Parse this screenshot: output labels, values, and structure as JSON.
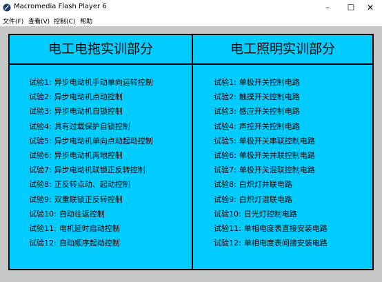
{
  "window": {
    "title": "Macromedia Flash Player 6",
    "minimize_glyph": "–",
    "maximize_glyph": "☐",
    "close_glyph": "✕"
  },
  "menu": [
    "文件(F)",
    "查看(V)",
    "控制(C)",
    "帮助"
  ],
  "left_column": {
    "title": "电工电拖实训部分",
    "items": [
      {
        "num": "试验1:",
        "text": "异步电动机手动单向运转控制"
      },
      {
        "num": "试验2:",
        "text": "异步电动机点动控制"
      },
      {
        "num": "试验3:",
        "text": "异步电动机自锁控制"
      },
      {
        "num": "试验4:",
        "text": "具有过载保护自锁控制"
      },
      {
        "num": "试验5:",
        "text": "异步电动机单向点动起动控制"
      },
      {
        "num": "试验6:",
        "text": "异步电动机两地控制"
      },
      {
        "num": "试验7:",
        "text": "异步电动机联锁正反转控制"
      },
      {
        "num": "试验8:",
        "text": "正反转点动、起动控制"
      },
      {
        "num": "试验9:",
        "text": "双重联锁正反转控制"
      },
      {
        "num": "试验10:",
        "text": "自动往返控制"
      },
      {
        "num": "试验11:",
        "text": "电机延时启动控制"
      },
      {
        "num": "试验12:",
        "text": "自动顺序起动控制"
      }
    ]
  },
  "right_column": {
    "title": "电工照明实训部分",
    "items": [
      {
        "num": "试验1:",
        "text": "单极开关控制电路"
      },
      {
        "num": "试验2:",
        "text": "触摸开关控制电路"
      },
      {
        "num": "试验3:",
        "text": "感应开关控制电路"
      },
      {
        "num": "试验4:",
        "text": "声控开关控制电路"
      },
      {
        "num": "试验5:",
        "text": "单极开关串联控制电路"
      },
      {
        "num": "试验6:",
        "text": "单极开关并联控制电路"
      },
      {
        "num": "试验7:",
        "text": "单极开关混联控制电路"
      },
      {
        "num": "试验8:",
        "text": "白炽灯并联电路"
      },
      {
        "num": "试验9:",
        "text": "白炽灯混联电路"
      },
      {
        "num": "试验10:",
        "text": "日光灯控制电路"
      },
      {
        "num": "试验11:",
        "text": "单相电度表直接安装电路"
      },
      {
        "num": "试验12:",
        "text": "单相电度表间接安装电路"
      }
    ]
  },
  "colors": {
    "panel_bg": "#00ccff",
    "stage_bg": "#c8c8c8",
    "border": "#000000"
  }
}
